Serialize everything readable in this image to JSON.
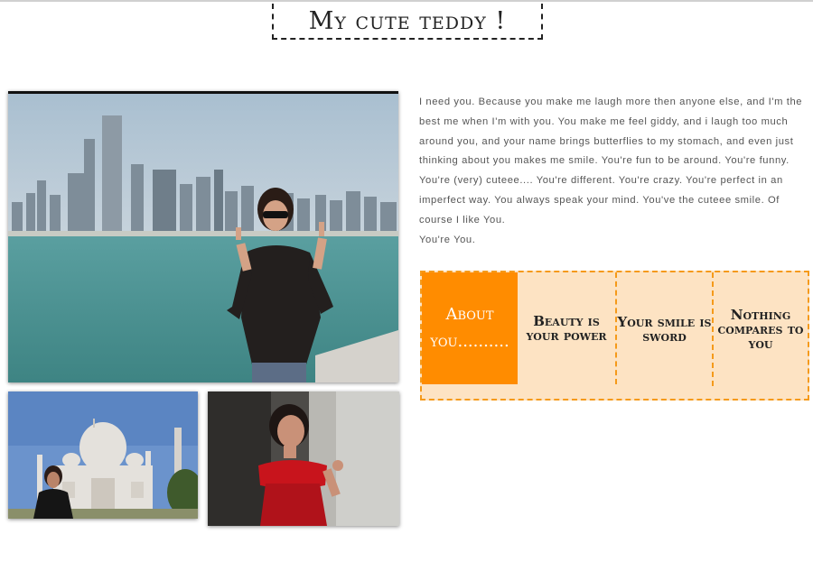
{
  "header": {
    "title": "My cute teddy !"
  },
  "photos": {
    "main": "woman-at-waterfront-photo",
    "taj": "woman-at-taj-mahal-photo",
    "red": "woman-in-red-dress-photo"
  },
  "intro": {
    "paragraph": "I need you. Because you make me laugh more then anyone else, and I'm the best me when I'm with you. You make me feel giddy, and i laugh too much around you, and your name brings butterflies to my stomach, and even just thinking about you makes me smile. You're fun to be around. You're funny. You're (very) cuteee.... You're different. You're crazy. You're perfect in an imperfect way. You always speak your mind. You've the cuteee smile. Of course I like You.",
    "closing": "You're You."
  },
  "menu": {
    "items": [
      {
        "label": "About you..........",
        "active": true
      },
      {
        "label": "Beauty is your power",
        "active": false
      },
      {
        "label": "Your smile is sword",
        "active": false
      },
      {
        "label": "Nothing compares to you",
        "active": false
      }
    ]
  },
  "colors": {
    "accent": "#ff8c00",
    "menu_background": "#fde3c3",
    "menu_border": "#f59a1a"
  }
}
